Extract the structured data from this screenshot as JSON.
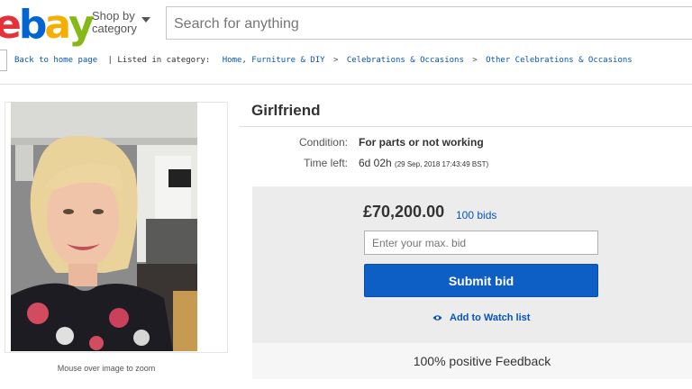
{
  "header": {
    "logo_letters": [
      {
        "char": "e",
        "color": "#e53238"
      },
      {
        "char": "b",
        "color": "#0064d2"
      },
      {
        "char": "a",
        "color": "#f5af02"
      },
      {
        "char": "y",
        "color": "#86b817"
      }
    ],
    "shop_by_line1": "Shop by",
    "shop_by_line2": "category",
    "search_placeholder": "Search for anything"
  },
  "breadcrumb": {
    "back": "Back to home page",
    "listed_in": "| Listed in category:",
    "crumbs": [
      "Home, Furniture & DIY",
      "Celebrations & Occasions",
      "Other Celebrations & Occasions"
    ],
    "separator": ">"
  },
  "listing": {
    "title": "Girlfriend",
    "condition_label": "Condition:",
    "condition_value": "For parts or not working",
    "time_left_label": "Time left:",
    "time_left_value": "6d 02h",
    "time_left_detail": "(29 Sep, 2018  17:43:49 BST)",
    "zoom_caption": "Mouse over image to zoom"
  },
  "bid": {
    "price": "£70,200.00",
    "bid_count": "100 bids",
    "input_placeholder": "Enter your max. bid",
    "submit_label": "Submit bid",
    "watch_label": "Add to Watch list",
    "feedback": "100% positive Feedback"
  },
  "colors": {
    "link": "#0654ba",
    "button": "#0e5fc5"
  }
}
